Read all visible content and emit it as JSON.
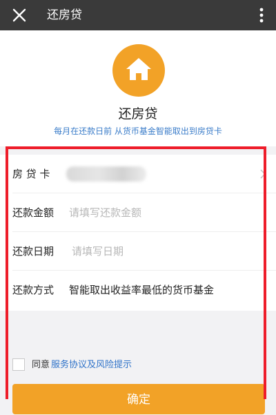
{
  "topbar": {
    "title": "还房贷",
    "close_icon": "close-icon",
    "more_icon": "more-vertical-icon"
  },
  "header": {
    "logo_icon": "home-icon",
    "name": "还房贷",
    "description": "每月在还款日前 从货币基金智能取出到房贷卡"
  },
  "form": {
    "rows": [
      {
        "label": "房 贷 卡",
        "value": ""
      },
      {
        "label": "还款金额",
        "placeholder": "请填写还款金额"
      },
      {
        "label": "还款日期",
        "placeholder": "请填写日期"
      },
      {
        "label": "还款方式",
        "value": "智能取出收益率最低的货币基金"
      }
    ]
  },
  "agreement": {
    "prefix": "同意",
    "link": "服务协议及风险提示",
    "checked": false
  },
  "confirm_button": {
    "label": "确定"
  },
  "colors": {
    "accent": "#f2a227",
    "link": "#2f73c9",
    "topbar": "#3a3a3a",
    "highlight": "#ee1d2a"
  }
}
